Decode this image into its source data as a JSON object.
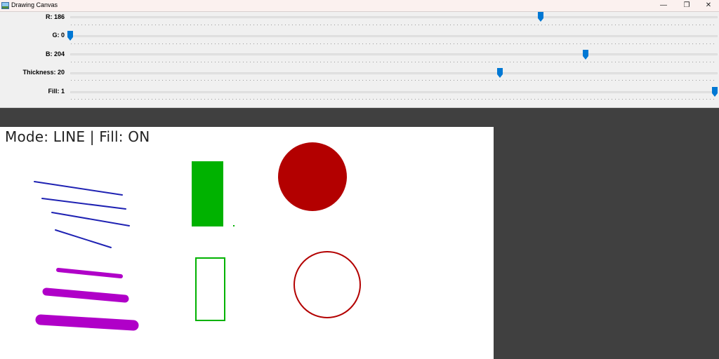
{
  "window": {
    "title": "Drawing Canvas"
  },
  "window_controls": {
    "minimize": "—",
    "maximize": "❐",
    "close": "✕"
  },
  "colors": {
    "accent_thumb": "#0078d4",
    "canvas_bg": "#ffffff",
    "workspace_bg": "#404040",
    "line_blue": "#1f22b3",
    "line_purple": "#b000c8",
    "rect_green": "#00b200",
    "circle_red": "#b30000"
  },
  "trackbars": [
    {
      "label": "R: 186",
      "value": 186,
      "max": 255
    },
    {
      "label": "G: 0",
      "value": 0,
      "max": 255
    },
    {
      "label": "B: 204",
      "value": 204,
      "max": 255
    },
    {
      "label": "Thickness: 20",
      "value": 20,
      "max": 30
    },
    {
      "label": "Fill: 1",
      "value": 1,
      "max": 1
    }
  ],
  "status": {
    "mode_text": "Mode: LINE | Fill: ON"
  }
}
